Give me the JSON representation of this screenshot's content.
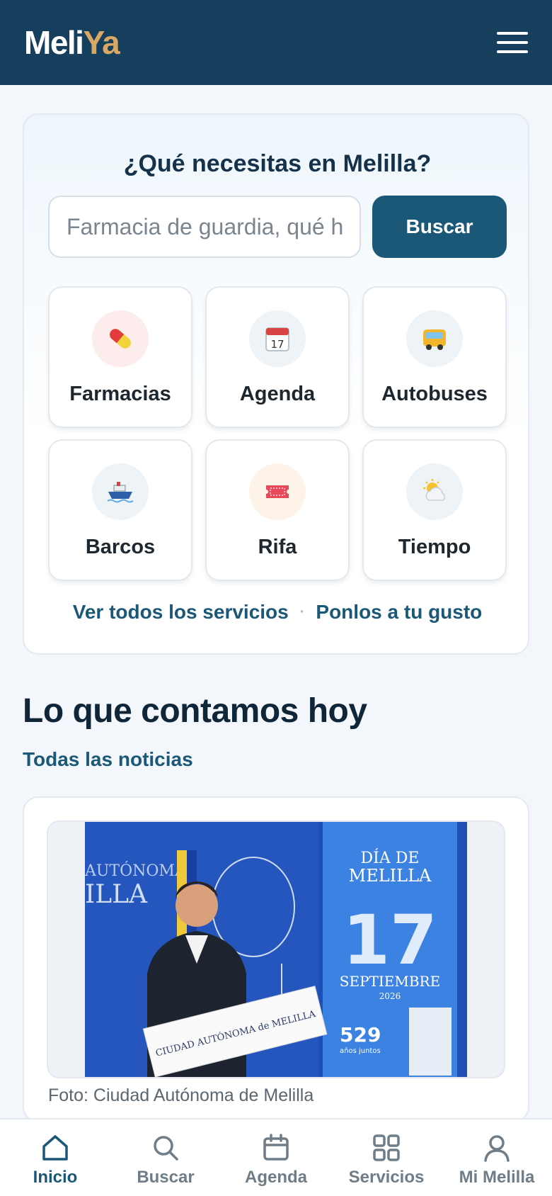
{
  "header": {
    "logo_part1": "Meli",
    "logo_part2": "Ya"
  },
  "search": {
    "title": "¿Qué necesitas en Melilla?",
    "placeholder": "Farmacia de guardia, qué hacer hoy...",
    "button_label": "Buscar"
  },
  "services": [
    {
      "label": "Farmacias",
      "icon": "pill-icon",
      "bg": "#fdecec"
    },
    {
      "label": "Agenda",
      "icon": "calendar-icon",
      "bg": "#eef3f7"
    },
    {
      "label": "Autobuses",
      "icon": "bus-icon",
      "bg": "#eef3f7"
    },
    {
      "label": "Barcos",
      "icon": "ship-icon",
      "bg": "#eef3f7"
    },
    {
      "label": "Rifa",
      "icon": "ticket-icon",
      "bg": "#fdf3e8"
    },
    {
      "label": "Tiempo",
      "icon": "sun-cloud-icon",
      "bg": "#eef3f7"
    }
  ],
  "links": {
    "all_services": "Ver todos los servicios",
    "separator": "·",
    "customize": "Ponlos a tu gusto"
  },
  "news": {
    "heading": "Lo que contamos hoy",
    "all_link": "Todas las noticias",
    "photo_caption": "Foto: Ciudad Autónoma de Melilla",
    "photo": {
      "backdrop_text_1": "AUTÓNOMA",
      "backdrop_text_2": "ILLA",
      "poster_title_1": "DÍA DE",
      "poster_title_2": "MELILLA",
      "poster_big_number": "17",
      "poster_month": "SEPTIEMBRE",
      "poster_year": "2026",
      "poster_count": "529",
      "poster_count_sub": "años juntos",
      "lectern_sign": "CIUDAD AUTÓNOMA de MELILLA"
    }
  },
  "bottom_nav": [
    {
      "label": "Inicio",
      "icon": "home-icon",
      "active": true
    },
    {
      "label": "Buscar",
      "icon": "search-icon",
      "active": false
    },
    {
      "label": "Agenda",
      "icon": "calendar-icon",
      "active": false
    },
    {
      "label": "Servicios",
      "icon": "grid-icon",
      "active": false
    },
    {
      "label": "Mi Melilla",
      "icon": "user-icon",
      "active": false
    }
  ],
  "colors": {
    "header_bg": "#163f5e",
    "accent": "#1b5777",
    "logo_accent": "#d8a864",
    "page_bg": "#f3f7fb"
  }
}
